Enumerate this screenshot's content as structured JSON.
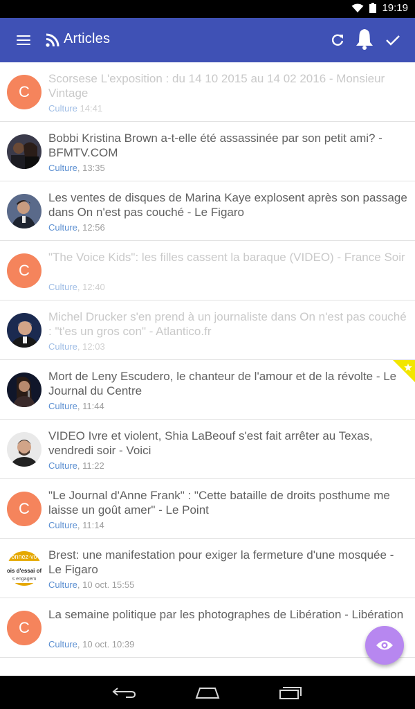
{
  "status_bar": {
    "time": "19:19"
  },
  "app_bar": {
    "title": "Articles"
  },
  "articles": [
    {
      "title": "Scorsese L'exposition : du 14 10 2015 au 14 02 2016 - Monsieur Vintage",
      "category": "Culture",
      "time": "14:41",
      "avatar_letter": "C",
      "read": true
    },
    {
      "title": "Bobbi Kristina Brown a-t-elle été assassinée par son petit ami? - BFMTV.COM",
      "category": "Culture",
      "time": "13:35",
      "read": false
    },
    {
      "title": "Les ventes de disques de Marina Kaye explosent après son passage dans On n'est pas couché - Le Figaro",
      "category": "Culture",
      "time": "12:56",
      "read": false
    },
    {
      "title": "\"The Voice Kids\": les filles cassent la baraque (VIDEO) - France Soir",
      "category": "Culture",
      "time": "12:40",
      "avatar_letter": "C",
      "read": true
    },
    {
      "title": "Michel Drucker s'en prend à un journaliste dans On n'est pas couché : \"t'es un gros con\" - Atlantico.fr",
      "category": "Culture",
      "time": "12:03",
      "read": true
    },
    {
      "title": "Mort de Leny Escudero, le chanteur de l'amour et de la révolte - Le Journal du Centre",
      "category": "Culture",
      "time": "11:44",
      "read": false,
      "starred": true
    },
    {
      "title": "VIDEO Ivre et violent, Shia LaBeouf s'est fait arrêter au Texas, vendredi soir - Voici",
      "category": "Culture",
      "time": "11:22",
      "read": false
    },
    {
      "title": "\"Le Journal d'Anne Frank\" : \"Cette bataille de droits posthume me laisse un goût amer\" - Le Point",
      "category": "Culture",
      "time": "11:14",
      "avatar_letter": "C",
      "read": false
    },
    {
      "title": "Brest: une manifestation pour exiger la fermeture d'une mosquée - Le Figaro",
      "category": "Culture",
      "time": "10 oct. 15:55",
      "avatar_text": [
        "onnez-vo",
        "ois d'essai of",
        "s engagem"
      ],
      "read": false
    },
    {
      "title": "La semaine politique par les photographes de Libération - Libération",
      "category": "Culture",
      "time": "10 oct. 10:39",
      "avatar_letter": "C",
      "read": false
    }
  ],
  "colors": {
    "app_bar": "#3f51b5",
    "avatar": "#f5845c",
    "category": "#5b8fd1",
    "fab": "#b787f0",
    "star": "#f2e600"
  }
}
